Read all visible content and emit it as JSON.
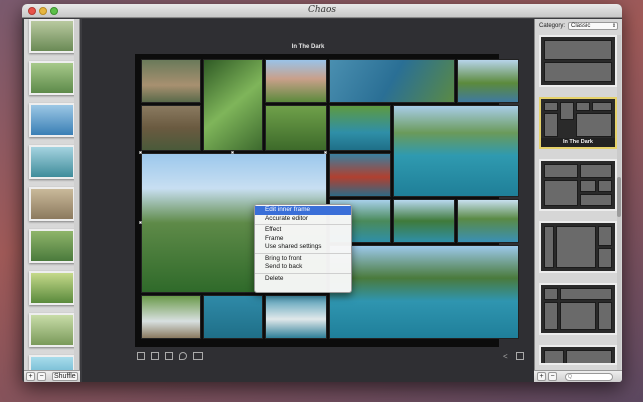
{
  "window": {
    "app_title": "Chaos"
  },
  "left_panel": {
    "thumbnail_colors": [
      [
        "#6a8a55",
        "#b9c9a0"
      ],
      [
        "#5d8a4a",
        "#a7c98a"
      ],
      [
        "#3a7fb5",
        "#9cc7e5"
      ],
      [
        "#3f8c9a",
        "#a5d3e0"
      ],
      [
        "#8c7a5e",
        "#c9b99a"
      ],
      [
        "#4a7a3c",
        "#8fb56a"
      ],
      [
        "#5a8a3c",
        "#c5d98a"
      ],
      [
        "#7a9a5a",
        "#c8dca8"
      ],
      [
        "#4aa0c0",
        "#a8dceb"
      ]
    ],
    "add_button": "+",
    "remove_button": "−",
    "shuffle_button": "Shuffle"
  },
  "canvas": {
    "collage_title": "In The Dark",
    "tool_icons": [
      "crop-icon",
      "frame-icon",
      "layout-icon",
      "drop-icon",
      "rectangle-icon"
    ]
  },
  "context_menu": {
    "items": [
      {
        "label": "Edit inner frame",
        "highlighted": true
      },
      {
        "label": "Accurate editor"
      },
      {
        "separator": true
      },
      {
        "label": "Effect"
      },
      {
        "label": "Frame"
      },
      {
        "label": "Use shared settings"
      },
      {
        "separator": true
      },
      {
        "label": "Bring to front"
      },
      {
        "label": "Send to back"
      },
      {
        "separator": true
      },
      {
        "label": "Delete"
      }
    ]
  },
  "right_panel": {
    "category_label": "Category:",
    "category_value": "Classic",
    "selected_layout_name": "In The Dark",
    "add_button": "+",
    "remove_button": "−",
    "search_placeholder": "Q"
  },
  "colors": {
    "selected_layout_border": "#e6d26a",
    "menu_highlight": "#3a6fd8"
  }
}
